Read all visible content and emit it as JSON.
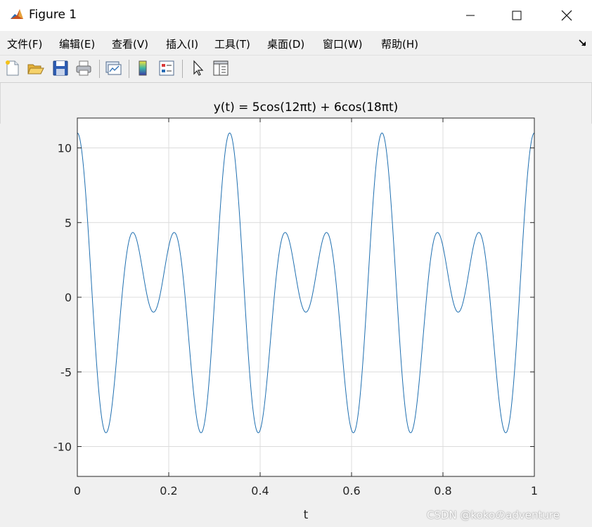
{
  "window": {
    "title": "Figure 1"
  },
  "menu": {
    "items": [
      {
        "label": "文件(F)"
      },
      {
        "label": "编辑(E)"
      },
      {
        "label": "查看(V)"
      },
      {
        "label": "插入(I)"
      },
      {
        "label": "工具(T)"
      },
      {
        "label": "桌面(D)"
      },
      {
        "label": "窗口(W)"
      },
      {
        "label": "帮助(H)"
      }
    ]
  },
  "toolbar": {
    "icons": [
      "new-file-icon",
      "open-folder-icon",
      "save-icon",
      "print-icon",
      "link-plot-icon",
      "colorbar-icon",
      "legend-icon",
      "pointer-icon",
      "property-inspector-icon"
    ]
  },
  "watermark": "CSDN @kokoのadventure",
  "colors": {
    "line": "#1f6fb0",
    "grid": "#dcdcdc",
    "axes_bg": "#ffffff",
    "figure_bg": "#f0f0f0"
  },
  "chart_data": {
    "type": "line",
    "title": "y(t) = 5cos(12πt) + 6cos(18πt)",
    "xlabel": "t",
    "ylabel": "",
    "xlim": [
      0,
      1
    ],
    "ylim": [
      -12,
      12
    ],
    "xticks": [
      0,
      0.2,
      0.4,
      0.6,
      0.8,
      1
    ],
    "xtick_labels": [
      "0",
      "0.2",
      "0.4",
      "0.6",
      "0.8",
      "1"
    ],
    "yticks": [
      -10,
      -5,
      0,
      5,
      10
    ],
    "ytick_labels": [
      "-10",
      "-5",
      "0",
      "5",
      "10"
    ],
    "grid": true,
    "series": [
      {
        "function": "5cos(12πt) + 6cos(18πt)",
        "x_start": 0,
        "x_end": 1,
        "sample_count": 1001
      }
    ]
  }
}
